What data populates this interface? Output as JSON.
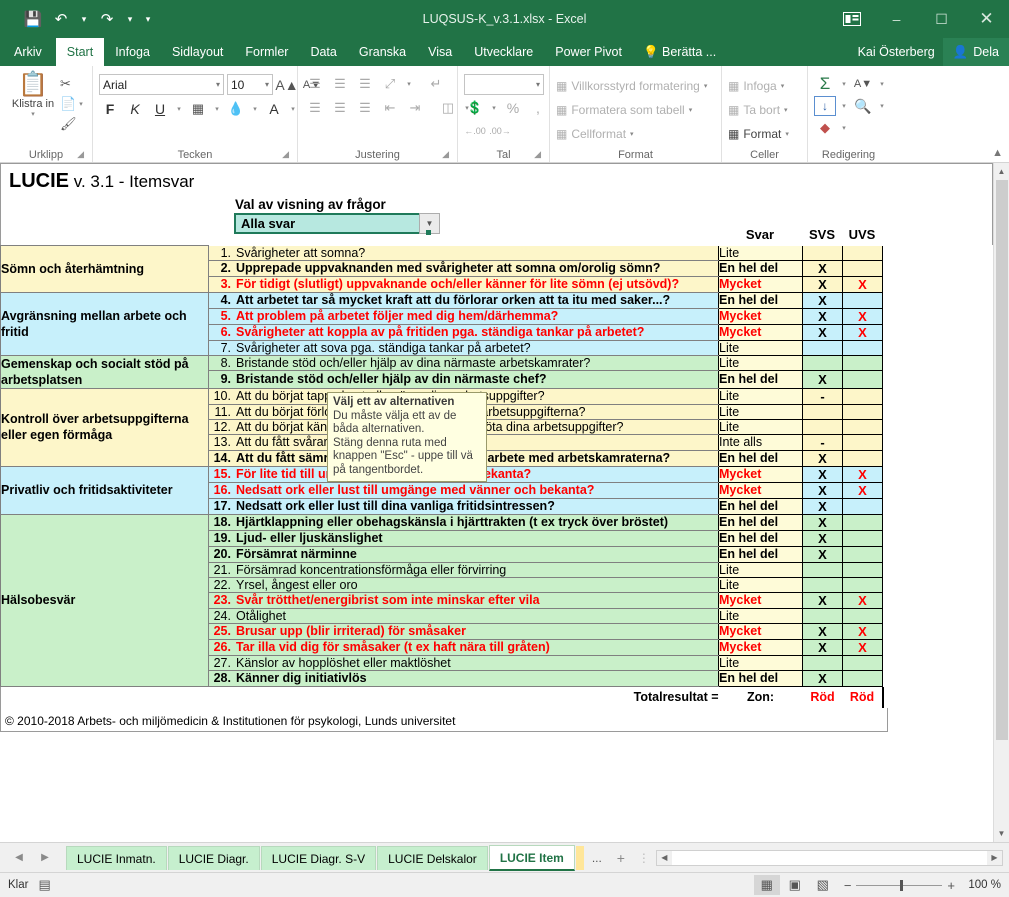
{
  "titlebar": {
    "save_icon": "save-icon",
    "undo_icon": "undo-icon",
    "redo_icon": "redo-icon",
    "qat_more_icon": "chevron-down-icon",
    "title": "LUQSUS-K_v.3.1.xlsx - Excel",
    "ribbon_display_icon": "ribbon-display-options-icon",
    "minimize": "–",
    "maximize": "☐",
    "close": "✕"
  },
  "ribbon_tabs": [
    {
      "label": "Arkiv",
      "active": false
    },
    {
      "label": "Start",
      "active": true
    },
    {
      "label": "Infoga",
      "active": false
    },
    {
      "label": "Sidlayout",
      "active": false
    },
    {
      "label": "Formler",
      "active": false
    },
    {
      "label": "Data",
      "active": false
    },
    {
      "label": "Granska",
      "active": false
    },
    {
      "label": "Visa",
      "active": false
    },
    {
      "label": "Utvecklare",
      "active": false
    },
    {
      "label": "Power Pivot",
      "active": false
    }
  ],
  "tell_me": "Berätta ...",
  "user_name": "Kai Österberg",
  "share_label": "Dela",
  "ribbon": {
    "clipboard": {
      "group_label": "Urklipp",
      "paste_label": "Klistra in",
      "cut_icon": "scissors-icon",
      "copy_icon": "copy-icon",
      "format_painter_icon": "format-painter-icon"
    },
    "font": {
      "group_label": "Tecken",
      "font_name": "Arial",
      "font_size": "10",
      "grow_font": "A",
      "shrink_font": "A",
      "bold": "F",
      "italic": "K",
      "underline": "U",
      "borders_icon": "borders-icon",
      "fill_icon": "fill-color-icon",
      "font_color": "A"
    },
    "alignment": {
      "group_label": "Justering",
      "align_top_icon": "align-top-icon",
      "align_middle_icon": "align-middle-icon",
      "align_bottom_icon": "align-bottom-icon",
      "orientation_icon": "text-orientation-icon",
      "align_left_icon": "align-left-icon",
      "align_center_icon": "align-center-icon",
      "align_right_icon": "align-right-icon",
      "decrease_indent_icon": "decrease-indent-icon",
      "increase_indent_icon": "increase-indent-icon",
      "wrap_text_icon": "wrap-text-icon",
      "merge_icon": "merge-cells-icon"
    },
    "number": {
      "group_label": "Tal",
      "format_value": "",
      "accounting_icon": "accounting-format-icon",
      "percent": "%",
      "comma": " ,",
      "decrease_decimal": "←.00",
      "increase_decimal": ".00→"
    },
    "styles": {
      "group_label": "Format",
      "conditional": "Villkorsstyrd formatering",
      "as_table": "Formatera som tabell",
      "cell_styles": "Cellformat"
    },
    "cells": {
      "group_label": "Celler",
      "insert": "Infoga",
      "delete": "Ta bort",
      "format": "Format"
    },
    "editing": {
      "group_label": "Redigering",
      "autosum_icon": "autosum-sigma-icon",
      "fill_icon": "fill-down-icon",
      "sort_filter_icon": "sort-filter-icon",
      "find_icon": "find-magnifier-icon",
      "clear_icon": "clear-eraser-icon"
    },
    "collapse_icon": "collapse-ribbon-icon"
  },
  "sheet": {
    "title_bold": "LUCIE",
    "title_rest": " v. 3.1 - Itemsvar",
    "selector_label": "Val av visning av frågor",
    "selector_value": "Alla svar",
    "selector_caret": "▼",
    "tooltip": {
      "heading": "Välj ett av alternativen",
      "lines": [
        "Du måste välja ett av de",
        "båda alternativen.",
        "Stäng denna ruta med",
        "knappen \"Esc\" - uppe till vä",
        "på tangentbordet."
      ]
    },
    "columns": {
      "svar": "Svar",
      "svs": "SVS",
      "uvs": "UVS"
    },
    "sections": [
      {
        "name": "Sömn och återhämtning",
        "color": "#fdf6c9",
        "rows": [
          {
            "num": "1.",
            "text": "Svårigheter att somna?",
            "bold": false,
            "red": false,
            "answer": "Lite",
            "ans_bold": false,
            "ans_red": false,
            "svs": "",
            "uvs": ""
          },
          {
            "num": "2.",
            "text": "Upprepade uppvaknanden med svårigheter att somna om/orolig sömn?",
            "bold": true,
            "red": false,
            "answer": "En hel del",
            "ans_bold": true,
            "ans_red": false,
            "svs": "X",
            "uvs": ""
          },
          {
            "num": "3.",
            "text": "För tidigt (slutligt) uppvaknande och/eller känner för lite sömn (ej utsövd)?",
            "bold": true,
            "red": true,
            "answer": "Mycket",
            "ans_bold": true,
            "ans_red": true,
            "svs": "X",
            "uvs": "X"
          }
        ]
      },
      {
        "name": "Avgränsning mellan arbete och fritid",
        "color": "#c7f0fb",
        "rows": [
          {
            "num": "4.",
            "text": "Att arbetet tar så mycket kraft att du förlorar orken att ta itu med saker...?",
            "bold": true,
            "red": false,
            "answer": "En hel del",
            "ans_bold": true,
            "ans_red": false,
            "svs": "X",
            "uvs": ""
          },
          {
            "num": "5.",
            "text": "Att problem på arbetet följer med dig hem/därhemma?",
            "bold": true,
            "red": true,
            "answer": "Mycket",
            "ans_bold": true,
            "ans_red": true,
            "svs": "X",
            "uvs": "X"
          },
          {
            "num": "6.",
            "text": "Svårigheter att koppla av på fritiden pga. ständiga tankar på arbetet?",
            "bold": true,
            "red": true,
            "answer": "Mycket",
            "ans_bold": true,
            "ans_red": true,
            "svs": "X",
            "uvs": "X"
          },
          {
            "num": "7.",
            "text": "Svårigheter att sova pga. ständiga tankar på arbetet?",
            "bold": false,
            "red": false,
            "answer": "Lite",
            "ans_bold": false,
            "ans_red": false,
            "svs": "",
            "uvs": ""
          }
        ]
      },
      {
        "name": "Gemenskap och socialt stöd på arbetsplatsen",
        "color": "#c9f0c9",
        "rows": [
          {
            "num": "8.",
            "text": "Bristande stöd och/eller hjälp av dina närmaste arbetskamrater?",
            "bold": false,
            "red": false,
            "answer": "Lite",
            "ans_bold": false,
            "ans_red": false,
            "svs": "",
            "uvs": ""
          },
          {
            "num": "9.",
            "text": "Bristande stöd och/eller hjälp av din närmaste chef?",
            "bold": true,
            "red": false,
            "answer": "En hel del",
            "ans_bold": true,
            "ans_red": false,
            "svs": "X",
            "uvs": ""
          }
        ]
      },
      {
        "name": "Kontroll över arbetsuppgifterna eller egen förmåga",
        "color": "#fdf6c9",
        "rows": [
          {
            "num": "10.",
            "text": "Att du börjat tappa kontrollen över dina arbetsuppgifter?",
            "bold": false,
            "red": false,
            "answer": "Lite",
            "ans_bold": false,
            "ans_red": false,
            "svs": "-",
            "uvs": ""
          },
          {
            "num": "11.",
            "text": "Att du börjat förlora din entusiasm/glädje för arbetsuppgifterna?",
            "bold": false,
            "red": false,
            "answer": "Lite",
            "ans_bold": false,
            "ans_red": false,
            "svs": "",
            "uvs": ""
          },
          {
            "num": "12.",
            "text": "Att du börjat känna dig mindre effektiv i att sköta dina arbetsuppgifter?",
            "bold": false,
            "red": false,
            "answer": "Lite",
            "ans_bold": false,
            "ans_red": false,
            "svs": "",
            "uvs": ""
          },
          {
            "num": "13.",
            "text": "Att du fått svårare att fatta beslut i arbetet?",
            "bold": false,
            "red": false,
            "answer": "Inte alls",
            "ans_bold": false,
            "ans_red": false,
            "svs": "-",
            "uvs": ""
          },
          {
            "num": "14.",
            "text": "Att du fått sämre tålamod eller ork för samarbete med arbetskamraterna?",
            "bold": true,
            "red": false,
            "answer": "En hel del",
            "ans_bold": true,
            "ans_red": false,
            "svs": "X",
            "uvs": ""
          }
        ]
      },
      {
        "name": "Privatliv och fritidsaktiviteter",
        "color": "#c7f0fb",
        "rows": [
          {
            "num": "15.",
            "text": "För lite tid till umgänge med vänner och bekanta?",
            "bold": true,
            "red": true,
            "answer": "Mycket",
            "ans_bold": true,
            "ans_red": true,
            "svs": "X",
            "uvs": "X"
          },
          {
            "num": "16.",
            "text": "Nedsatt ork eller lust till umgänge med vänner och bekanta?",
            "bold": true,
            "red": true,
            "answer": "Mycket",
            "ans_bold": true,
            "ans_red": true,
            "svs": "X",
            "uvs": "X"
          },
          {
            "num": "17.",
            "text": "Nedsatt ork eller lust till dina vanliga fritidsintressen?",
            "bold": true,
            "red": false,
            "answer": "En hel del",
            "ans_bold": true,
            "ans_red": false,
            "svs": "X",
            "uvs": ""
          }
        ]
      },
      {
        "name": "Hälsobesvär",
        "color": "#c9f0c9",
        "rows": [
          {
            "num": "18.",
            "text": "Hjärtklappning eller obehagskänsla i hjärttrakten (t ex tryck över bröstet)",
            "bold": true,
            "red": false,
            "answer": "En hel del",
            "ans_bold": true,
            "ans_red": false,
            "svs": "X",
            "uvs": ""
          },
          {
            "num": "19.",
            "text": "Ljud- eller ljuskänslighet",
            "bold": true,
            "red": false,
            "answer": "En hel del",
            "ans_bold": true,
            "ans_red": false,
            "svs": "X",
            "uvs": ""
          },
          {
            "num": "20.",
            "text": "Försämrat närminne",
            "bold": true,
            "red": false,
            "answer": "En hel del",
            "ans_bold": true,
            "ans_red": false,
            "svs": "X",
            "uvs": ""
          },
          {
            "num": "21.",
            "text": "Försämrad koncentrationsförmåga eller förvirring",
            "bold": false,
            "red": false,
            "answer": "Lite",
            "ans_bold": false,
            "ans_red": false,
            "svs": "",
            "uvs": ""
          },
          {
            "num": "22.",
            "text": "Yrsel, ångest eller oro",
            "bold": false,
            "red": false,
            "answer": "Lite",
            "ans_bold": false,
            "ans_red": false,
            "svs": "",
            "uvs": ""
          },
          {
            "num": "23.",
            "text": "Svår trötthet/energibrist som inte minskar efter vila",
            "bold": true,
            "red": true,
            "answer": "Mycket",
            "ans_bold": true,
            "ans_red": true,
            "svs": "X",
            "uvs": "X"
          },
          {
            "num": "24.",
            "text": "Otålighet",
            "bold": false,
            "red": false,
            "answer": "Lite",
            "ans_bold": false,
            "ans_red": false,
            "svs": "",
            "uvs": ""
          },
          {
            "num": "25.",
            "text": "Brusar upp (blir irriterad) för småsaker",
            "bold": true,
            "red": true,
            "answer": "Mycket",
            "ans_bold": true,
            "ans_red": true,
            "svs": "X",
            "uvs": "X"
          },
          {
            "num": "26.",
            "text": "Tar illa vid dig för småsaker (t ex haft nära till gråten)",
            "bold": true,
            "red": true,
            "answer": "Mycket",
            "ans_bold": true,
            "ans_red": true,
            "svs": "X",
            "uvs": "X"
          },
          {
            "num": "27.",
            "text": "Känslor av hopplöshet eller maktlöshet",
            "bold": false,
            "red": false,
            "answer": "Lite",
            "ans_bold": false,
            "ans_red": false,
            "svs": "",
            "uvs": ""
          },
          {
            "num": "28.",
            "text": "Känner dig initiativlös",
            "bold": true,
            "red": false,
            "answer": "En hel del",
            "ans_bold": true,
            "ans_red": false,
            "svs": "X",
            "uvs": ""
          }
        ]
      }
    ],
    "total_label": "Totalresultat =",
    "zon_label": "Zon:",
    "zon_svs": "Röd",
    "zon_uvs": "Röd",
    "copyright": "© 2010-2018 Arbets- och miljömedicin & Institutionen för psykologi, Lunds universitet"
  },
  "sheet_tabs": {
    "prev_icon": "◀",
    "next_icon": "▶",
    "tabs": [
      {
        "label": "LUCIE Inmatn.",
        "active": false
      },
      {
        "label": "LUCIE Diagr.",
        "active": false
      },
      {
        "label": "LUCIE Diagr. S-V",
        "active": false
      },
      {
        "label": "LUCIE Delskalor",
        "active": false
      },
      {
        "label": "LUCIE Item",
        "active": true
      }
    ],
    "more": "...",
    "add_icon": "+"
  },
  "statusbar": {
    "status": "Klar",
    "accessibility_icon": "accessibility-check-icon",
    "normal_view_icon": "normal-view-icon",
    "page_layout_icon": "page-layout-view-icon",
    "page_break_icon": "page-break-view-icon",
    "zoom_out": "−",
    "zoom_in": "+",
    "zoom": "100 %"
  },
  "colors": {
    "brand_green": "#217346",
    "red": "#ff0000",
    "answer_bg": "#fefbd8"
  }
}
